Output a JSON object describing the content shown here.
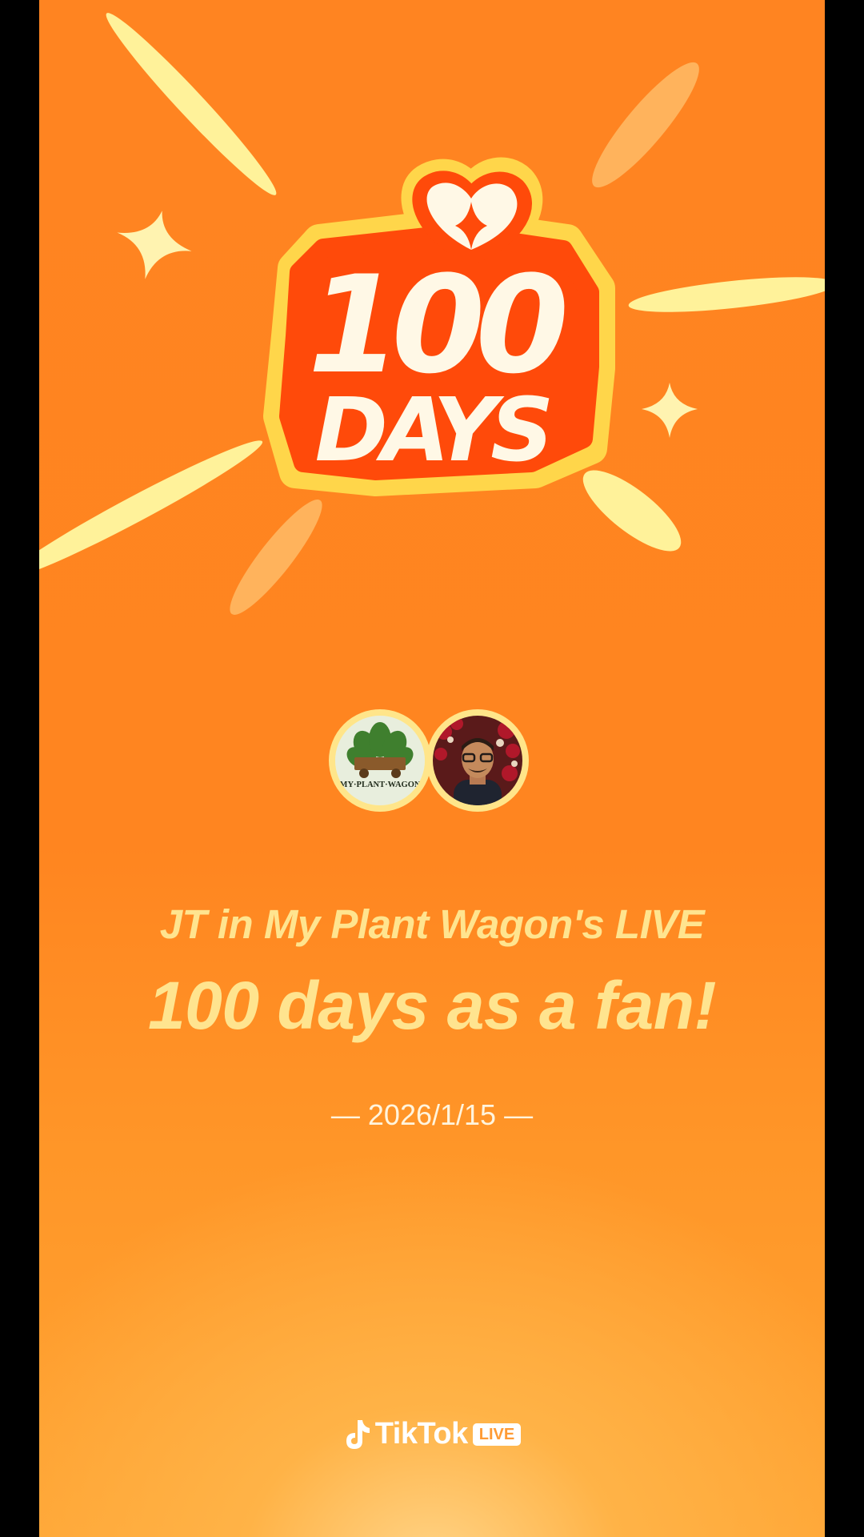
{
  "badge": {
    "number": "100",
    "word": "DAYS"
  },
  "avatars": [
    {
      "name": "My Plant Wagon",
      "logo_text": "MY·PLANT·WAGON"
    },
    {
      "name": "JT"
    }
  ],
  "headline": "JT in My Plant Wagon's LIVE",
  "subheadline": "100 days as a fan!",
  "date": "— 2026/1/15 —",
  "brand": {
    "name": "TikTok",
    "badge": "LIVE"
  },
  "colors": {
    "background": "#ff8420",
    "accent_yellow": "#ffe48f",
    "badge_red": "#ff4a0a"
  }
}
